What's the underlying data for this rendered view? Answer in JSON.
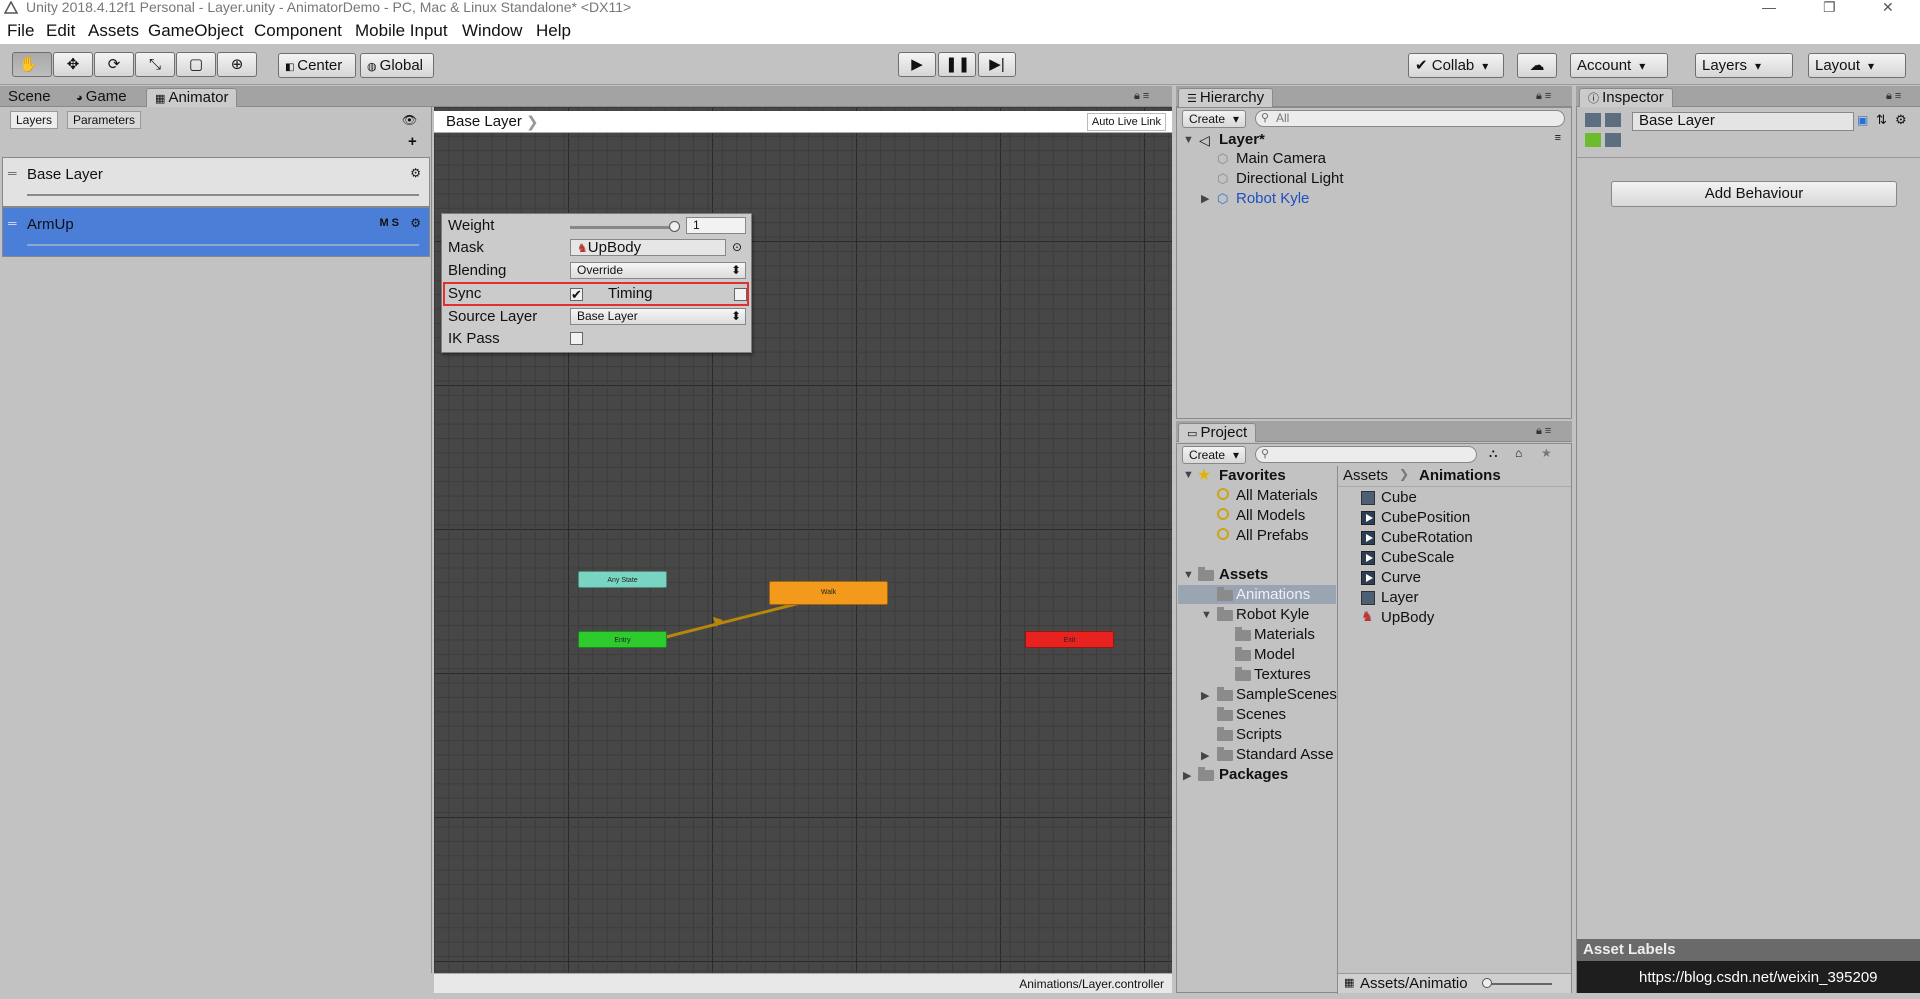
{
  "window": {
    "title": "Unity 2018.4.12f1 Personal - Layer.unity - AnimatorDemo - PC, Mac & Linux Standalone* <DX11>",
    "controls": [
      "—",
      "❐",
      "✕"
    ]
  },
  "menu": [
    "File",
    "Edit",
    "Assets",
    "GameObject",
    "Component",
    "Mobile Input",
    "Window",
    "Help"
  ],
  "toolbar": {
    "pivot": "Center",
    "space": "Global",
    "collab": "Collab",
    "account": "Account",
    "layers": "Layers",
    "layout": "Layout"
  },
  "tabs": {
    "scene": "Scene",
    "game": "Game",
    "animator": "Animator",
    "hierarchy": "Hierarchy",
    "project": "Project",
    "inspector": "Inspector"
  },
  "animator": {
    "subtabs": [
      "Layers",
      "Parameters"
    ],
    "layers": [
      {
        "name": "Base Layer",
        "flags": ""
      },
      {
        "name": "ArmUp",
        "flags": "M S"
      }
    ],
    "breadcrumb": "Base Layer",
    "live_link": "Auto Live Link",
    "footer": "Animations/Layer.controller",
    "states": {
      "any": "Any State",
      "entry": "Entry",
      "walk": "Walk",
      "exit": "Exit"
    },
    "settings": {
      "weight_label": "Weight",
      "weight_value": "1",
      "weight_fraction": 1.0,
      "mask_label": "Mask",
      "mask_value": "UpBody",
      "blending_label": "Blending",
      "blending_value": "Override",
      "sync_label": "Sync",
      "sync_checked": true,
      "timing_label": "Timing",
      "timing_checked": false,
      "source_label": "Source Layer",
      "source_value": "Base Layer",
      "ik_label": "IK Pass",
      "ik_checked": false
    },
    "highlight_color": "#e03030"
  },
  "hierarchy": {
    "create": "Create",
    "search_placeholder": "All",
    "scene": "Layer*",
    "items": [
      "Main Camera",
      "Directional Light",
      "Robot Kyle"
    ]
  },
  "project": {
    "create": "Create",
    "favorites": {
      "label": "Favorites",
      "items": [
        "All Materials",
        "All Models",
        "All Prefabs"
      ]
    },
    "assets_label": "Assets",
    "tree": [
      "Animations",
      "Robot Kyle",
      "Materials",
      "Model",
      "Textures",
      "SampleScenes",
      "Scenes",
      "Scripts",
      "Standard Asse",
      "Packages"
    ],
    "breadcrumb": [
      "Assets",
      "Animations"
    ],
    "files": [
      "Cube",
      "CubePosition",
      "CubeRotation",
      "CubeScale",
      "Curve",
      "Layer",
      "UpBody"
    ],
    "footer": "Assets/Animatio"
  },
  "inspector": {
    "name": "Base Layer",
    "add_button": "Add Behaviour",
    "asset_labels": "Asset Labels",
    "watermark": "https://blog.csdn.net/weixin_395209"
  }
}
